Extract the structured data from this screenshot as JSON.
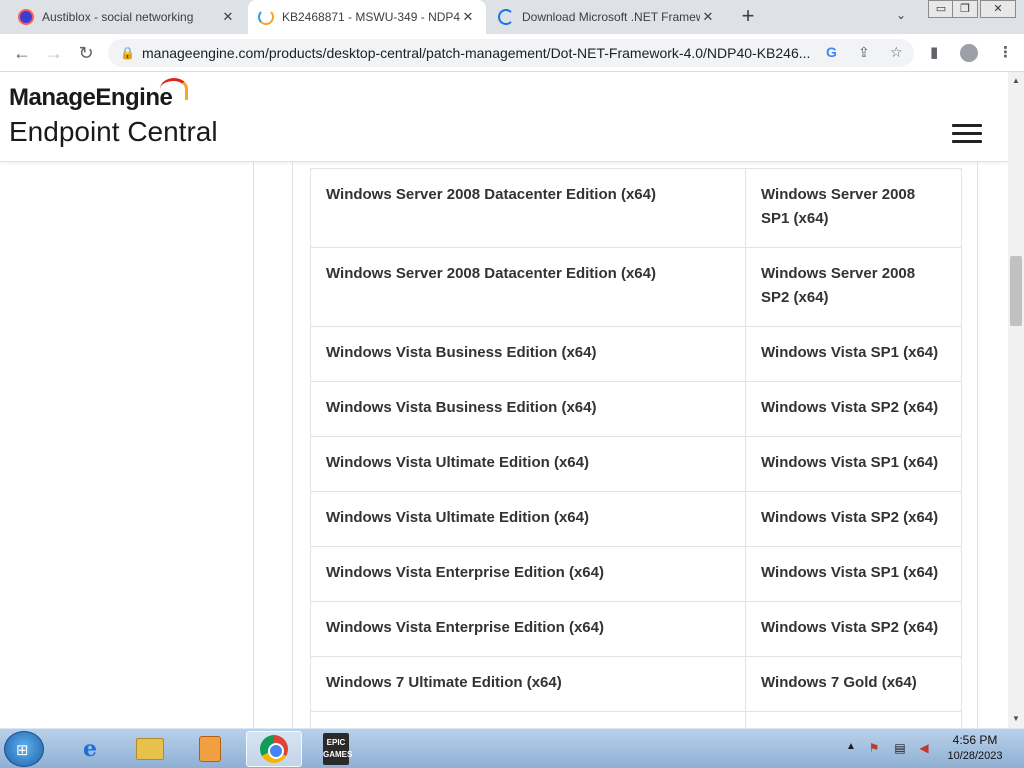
{
  "browser": {
    "tabs": [
      {
        "title": "Austiblox - social networking",
        "icon": "austiblox-icon",
        "active": false
      },
      {
        "title": "KB2468871 - MSWU-349 - NDP4",
        "icon": "manageengine-icon",
        "active": true
      },
      {
        "title": "Download Microsoft .NET Framew",
        "icon": "loading-icon",
        "active": false
      }
    ],
    "url": "manageengine.com/products/desktop-central/patch-management/Dot-NET-Framework-4.0/NDP40-KB246...",
    "window_controls": {
      "minimize": "▭",
      "maximize": "❐",
      "close": "✕"
    },
    "new_tab": "+",
    "tab_menu": "⌄"
  },
  "site": {
    "brand": "ManageEngine",
    "product": "Endpoint Central"
  },
  "table": {
    "rows": [
      {
        "product": "Windows Server 2008 Datacenter Edition (x64)",
        "service_pack": "Windows Server 2008 SP1 (x64)"
      },
      {
        "product": "Windows Server 2008 Datacenter Edition (x64)",
        "service_pack": "Windows Server 2008 SP2 (x64)"
      },
      {
        "product": "Windows Vista Business Edition (x64)",
        "service_pack": "Windows Vista SP1 (x64)"
      },
      {
        "product": "Windows Vista Business Edition (x64)",
        "service_pack": "Windows Vista SP2 (x64)"
      },
      {
        "product": "Windows Vista Ultimate Edition (x64)",
        "service_pack": "Windows Vista SP1 (x64)"
      },
      {
        "product": "Windows Vista Ultimate Edition (x64)",
        "service_pack": "Windows Vista SP2 (x64)"
      },
      {
        "product": "Windows Vista Enterprise Edition (x64)",
        "service_pack": "Windows Vista SP1 (x64)"
      },
      {
        "product": "Windows Vista Enterprise Edition (x64)",
        "service_pack": "Windows Vista SP2 (x64)"
      },
      {
        "product": "Windows 7 Ultimate Edition (x64)",
        "service_pack": "Windows 7 Gold (x64)"
      }
    ]
  },
  "taskbar": {
    "epic_label": "EPIC GAMES",
    "time": "4:56 PM",
    "date": "10/28/2023"
  }
}
